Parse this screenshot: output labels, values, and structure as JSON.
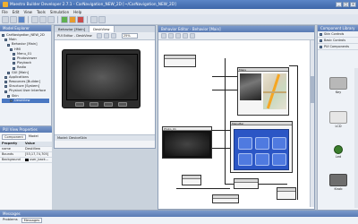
{
  "window": {
    "title": "Maestro Builder Developer 2.7.1 - CarNavigation_NEW_2D [~/CarNavigation_NEW_2D]",
    "controls": [
      "_",
      "□",
      "×"
    ]
  },
  "menu": [
    "File",
    "Edit",
    "View",
    "Tools",
    "Simulation",
    "Help"
  ],
  "model_explorer": {
    "title": "Model Explorer",
    "tree": [
      {
        "label": "CarNavigation_NEW_2D"
      },
      {
        "label": "Main"
      },
      {
        "label": "Behavior [Main]"
      },
      {
        "label": "HMI"
      },
      {
        "label": "Menu_01"
      },
      {
        "label": "Photoviewer"
      },
      {
        "label": "Playback"
      },
      {
        "label": "Radio"
      },
      {
        "label": "GUI [Main]"
      },
      {
        "label": "Applications"
      },
      {
        "label": "Resources [Builder]"
      },
      {
        "label": "Structure [System]"
      },
      {
        "label": "Physical User Interface"
      },
      {
        "label": "Skin"
      },
      {
        "label": "DeskView"
      }
    ]
  },
  "properties": {
    "title": "PUI View Properties",
    "tabs": [
      "Component",
      "Model"
    ],
    "columns": [
      "Property",
      "Value"
    ],
    "rows": [
      {
        "property": "name",
        "value": "DeskView"
      },
      {
        "property": "Bounds",
        "value": "[53,17,74,705]"
      },
      {
        "property": "Background",
        "value": "user_back..."
      }
    ]
  },
  "gui_editor": {
    "tabs": [
      "Behavior [Main]",
      "DeskView"
    ],
    "title": "PUI Editor - DeskView",
    "zoom": "25%",
    "model_label": "Model: DeviceSkin"
  },
  "behavior_editor": {
    "title": "Behavior Editor - Behavior [Main]",
    "nodes": [
      {
        "label": "Photo_01"
      },
      {
        "label": "Maps"
      },
      {
        "label": "MenuBar"
      }
    ]
  },
  "component_library": {
    "title": "Component Library",
    "categories": [
      "Skin Controls",
      "Basic Controls",
      "PUI Components"
    ],
    "items": [
      {
        "label": "Key",
        "color": "#b8b8b8"
      },
      {
        "label": "LCD",
        "color": "#e6e6e6"
      },
      {
        "label": "Led",
        "color": "#3a7d2c"
      },
      {
        "label": "Knob",
        "color": "#6e6e6e"
      }
    ]
  },
  "messages": {
    "title": "Messages",
    "tabs": [
      "Problems",
      "Messages"
    ]
  }
}
